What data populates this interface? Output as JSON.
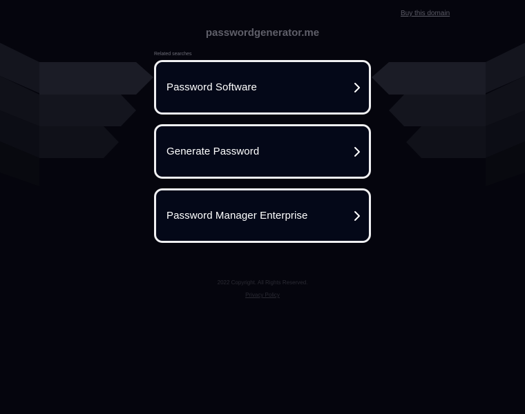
{
  "header": {
    "buy_link": "Buy this domain",
    "domain": "passwordgenerator.me"
  },
  "related": {
    "label": "Related searches",
    "items": [
      {
        "label": "Password Software"
      },
      {
        "label": "Generate Password"
      },
      {
        "label": "Password Manager Enterprise"
      }
    ]
  },
  "footer": {
    "copyright": "2022 Copyright. All Rights Reserved.",
    "privacy": "Privacy Policy"
  },
  "colors": {
    "background": "#05050d",
    "card_background": "#040818",
    "card_border": "#f0f0f2"
  },
  "icons": {
    "result_arrow": "chevron-right-icon"
  }
}
